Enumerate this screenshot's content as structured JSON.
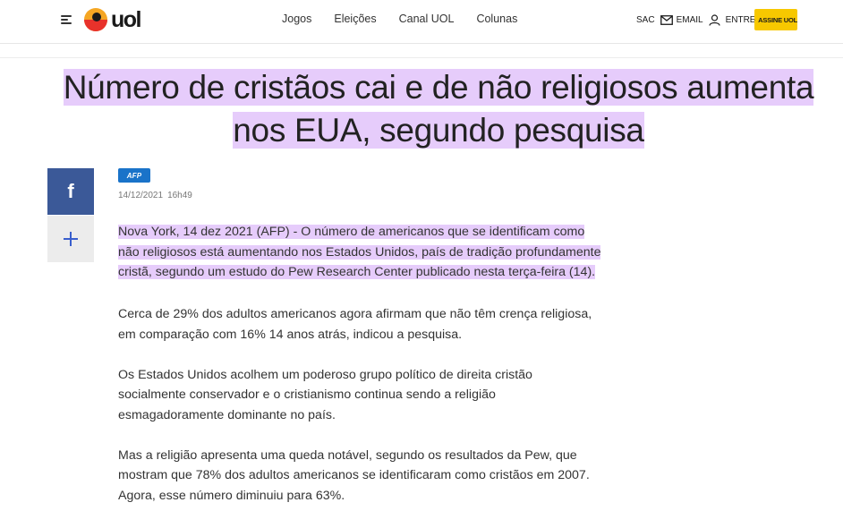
{
  "header": {
    "logo_text": "uol",
    "nav": [
      "Jogos",
      "Eleições",
      "Canal UOL",
      "Colunas"
    ],
    "sac_label": "SAC",
    "email_label": "EMAIL",
    "login_label": "ENTRE",
    "subscribe_label": "ASSINE UOL"
  },
  "article": {
    "title_line1": "Número de cristãos cai e de não religiosos aumenta",
    "title_line2": "nos EUA, segundo pesquisa",
    "agency": "AFP",
    "date": "14/12/2021",
    "time": "16h49",
    "paragraphs": [
      "Nova York, 14 dez 2021 (AFP) - O número de americanos que se identificam como não religiosos está aumentando nos Estados Unidos, país de tradição profundamente cristã, segundo um estudo do Pew Research Center publicado nesta terça-feira (14).",
      "Cerca de 29% dos adultos americanos agora afirmam que não têm crença religiosa, em comparação com 16% 14 anos atrás, indicou a pesquisa.",
      "Os Estados Unidos acolhem um poderoso grupo político de direita cristão socialmente conservador e o cristianismo continua sendo a religião esmagadoramente dominante no país.",
      "Mas a religião apresenta uma queda notável, segundo os resultados da Pew, que mostram que 78% dos adultos americanos se identificaram como cristãos em 2007. Agora, esse número diminuiu para 63%."
    ]
  },
  "share": {
    "facebook_glyph": "f",
    "more_glyph": "+"
  },
  "colors": {
    "highlight": "#e6ccfb",
    "facebook": "#3b5998",
    "subscribe": "#f7c800",
    "logo_sun": "#f5a623",
    "logo_sun_red": "#e8322b"
  }
}
